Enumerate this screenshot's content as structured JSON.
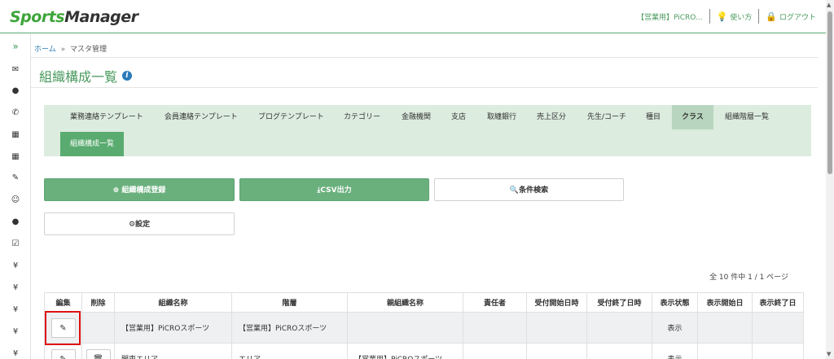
{
  "header": {
    "logo_part1": "Sports",
    "logo_part2": "Manager",
    "org": "【営業用】PiCRO...",
    "help": "使い方",
    "logout": "ログアウト"
  },
  "rail": [
    "»",
    "✉",
    "●",
    "✆",
    "▦",
    "▦",
    "✎",
    "☺",
    "●",
    "☑",
    "¥",
    "¥",
    "¥",
    "¥",
    "¥"
  ],
  "breadcrumb": {
    "home": "ホーム",
    "sep": "»",
    "current": "マスタ管理"
  },
  "page_title": "組織構成一覧",
  "tabs": [
    "業務連絡テンプレート",
    "会員連絡テンプレート",
    "ブログテンプレート",
    "カテゴリー",
    "金融機関",
    "支店",
    "取纏銀行",
    "売上区分",
    "先生/コーチ",
    "種目",
    "クラス",
    "組織階層一覧"
  ],
  "selected_tab": "組織構成一覧",
  "buttons": {
    "register": "組織構成登録",
    "csv": "CSV出力",
    "search": "条件検索",
    "settings": "設定"
  },
  "count_text": "全 10 件中 1 / 1 ページ",
  "table": {
    "headers": [
      "編集",
      "削除",
      "組織名称",
      "階層",
      "親組織名称",
      "責任者",
      "受付開始日時",
      "受付終了日時",
      "表示状態",
      "表示開始日",
      "表示終了日"
    ],
    "rows": [
      [
        "",
        "",
        "【営業用】PiCROスポーツ",
        "【営業用】PiCROスポーツ",
        "",
        "",
        "",
        "",
        "表示",
        "",
        ""
      ],
      [
        "",
        "",
        "関東エリア",
        "エリア",
        "【営業用】PiCROスポーツ",
        "",
        "",
        "",
        "表示",
        "",
        ""
      ]
    ]
  }
}
